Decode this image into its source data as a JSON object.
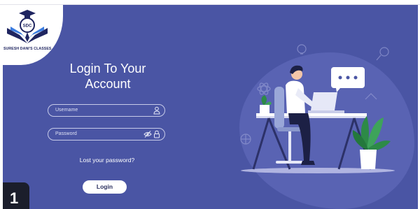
{
  "brand": {
    "name": "SURESH DANI'S CLASSES",
    "logo_mark": "SDC"
  },
  "login": {
    "title_line1": "Login To Your",
    "title_line2": "Account",
    "username_placeholder": "Username",
    "password_placeholder": "Password",
    "lost_password": "Lost your password?",
    "submit_label": "Login"
  },
  "overlay": {
    "step_number": "1"
  },
  "colors": {
    "background": "#4a55a4",
    "blob": "#5963b3",
    "accent_green": "#2d8a47"
  }
}
